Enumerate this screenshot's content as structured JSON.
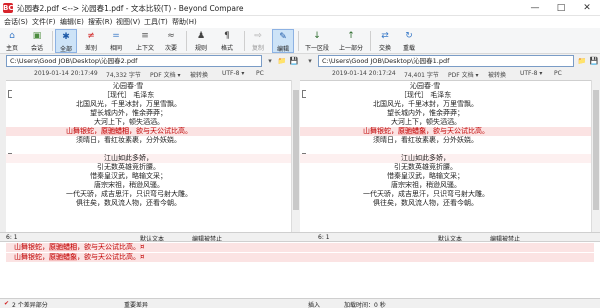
{
  "window": {
    "title": "沁园春2.pdf <--> 沁园春1.pdf - 文本比较(T) - Beyond Compare",
    "app_icon": "BC",
    "controls": [
      "—",
      "□",
      "✕"
    ]
  },
  "menu": [
    "会话(S)",
    "文件(F)",
    "编辑(E)",
    "搜索(R)",
    "视图(V)",
    "工具(T)",
    "帮助(H)"
  ],
  "toolbar": [
    {
      "label": "主页",
      "icon": "home-icon",
      "glyph": "⌂",
      "color": "#3a7ac8"
    },
    {
      "label": "会话",
      "icon": "session-icon",
      "glyph": "▣",
      "color": "#4d8d3f"
    },
    {
      "label": "全部",
      "icon": "all-icon",
      "glyph": "✱",
      "color": "#1e5aa8",
      "active": true
    },
    {
      "label": "差别",
      "icon": "diff-icon",
      "glyph": "≠",
      "color": "#d02020"
    },
    {
      "label": "相同",
      "icon": "same-icon",
      "glyph": "=",
      "color": "#3a7ac8"
    },
    {
      "label": "上下文",
      "icon": "context-icon",
      "glyph": "≡",
      "color": "#555"
    },
    {
      "label": "次要",
      "icon": "minor-icon",
      "glyph": "≈",
      "color": "#555"
    },
    {
      "label": "规则",
      "icon": "rules-icon",
      "glyph": "♟",
      "color": "#444"
    },
    {
      "label": "格式",
      "icon": "format-icon",
      "glyph": "¶",
      "color": "#444"
    },
    {
      "label": "复制",
      "icon": "copy-icon",
      "glyph": "⇨",
      "color": "#aaa",
      "disabled": true
    },
    {
      "label": "编辑",
      "icon": "edit-icon",
      "glyph": "✎",
      "color": "#1e5aa8",
      "active": true
    },
    {
      "label": "下一区段",
      "icon": "next-section-icon",
      "glyph": "↓",
      "color": "#2a6a2a"
    },
    {
      "label": "上一部分",
      "icon": "prev-section-icon",
      "glyph": "↑",
      "color": "#2a6a2a"
    },
    {
      "label": "交换",
      "icon": "swap-icon",
      "glyph": "⇄",
      "color": "#3a7ac8"
    },
    {
      "label": "重载",
      "icon": "reload-icon",
      "glyph": "↻",
      "color": "#3a7ac8"
    }
  ],
  "left": {
    "path": "C:\\Users\\Good JOB\\Desktop\\沁园春2.pdf",
    "info": [
      "2019-01-14 20:17:49",
      "74,332 字节",
      "PDF 文档 ▾",
      "被转换",
      "UTF-8 ▾",
      "PC"
    ],
    "lines": [
      {
        "text": "沁园春·雪",
        "diff": false
      },
      {
        "text": "［现代］ 毛泽东",
        "diff": false
      },
      {
        "text": "北国风光，千里冰封，万里雪飘。",
        "diff": false
      },
      {
        "text": "望长城内外，惟余莽莽；",
        "diff": false
      },
      {
        "text": "大河上下，顿失滔滔。",
        "diff": false
      },
      {
        "pre": "山舞银蛇，",
        "hl": "原驰蜡相",
        "post": "，欲与天公试比高。",
        "diff": true
      },
      {
        "text": "须晴日，看红妆素裹，分外妖娆。",
        "diff": false
      },
      {
        "text": "",
        "diff": false
      },
      {
        "text": "江山如此多娇，",
        "diff": true,
        "soft": true
      },
      {
        "text": "引无数英雄竞折腰。",
        "diff": false
      },
      {
        "text": "惜秦皇汉武，略输文采；",
        "diff": false
      },
      {
        "text": "唐宗宋祖，稍逊风骚。",
        "diff": false
      },
      {
        "text": "一代天骄，成吉思汗，只识弯弓射大雕。",
        "diff": false
      },
      {
        "text": "俱往矣，数风流人物，还看今朝。",
        "diff": false
      }
    ],
    "pos": "6: 1",
    "encoding": "默认文本",
    "edit": "编辑被禁止"
  },
  "right": {
    "path": "C:\\Users\\Good JOB\\Desktop\\沁园春1.pdf",
    "info": [
      "2019-01-14 20:17:24",
      "74,401 字节",
      "PDF 文档 ▾",
      "被转换",
      "UTF-8 ▾",
      "PC"
    ],
    "lines": [
      {
        "text": "沁园春·雪",
        "diff": false
      },
      {
        "text": "［现代］ 毛泽东",
        "diff": false
      },
      {
        "text": "北国风光，千里冰封，万里雪飘。",
        "diff": false
      },
      {
        "text": "望长城内外，惟余莽莽；",
        "diff": false
      },
      {
        "text": "大河上下，顿失滔滔。",
        "diff": false
      },
      {
        "pre": "山舞银蛇，",
        "hl": "原驰蜡象",
        "post": "，欲与天公试比高。",
        "diff": true
      },
      {
        "text": "须晴日，看红妆素裹，分外妖娆。",
        "diff": false
      },
      {
        "text": "",
        "diff": false
      },
      {
        "text": "江山如此多娇，",
        "diff": true,
        "soft": true
      },
      {
        "text": "引无数英雄竞折腰。",
        "diff": false
      },
      {
        "text": "惜秦皇汉武，略输文采；",
        "diff": false
      },
      {
        "text": "唐宗宋祖，稍逊风骚。",
        "diff": false
      },
      {
        "text": "一代天骄，成吉思汗，只识弯弓射大雕。",
        "diff": false
      },
      {
        "text": "俱往矣，数风流人物，还看今朝。",
        "diff": false
      }
    ],
    "pos": "6: 1",
    "encoding": "默认文本",
    "edit": "编辑被禁止"
  },
  "detail": [
    {
      "pre": "山舞银蛇，",
      "hl": "原驰蜡相",
      "post": "，欲与天公试比高。¤"
    },
    {
      "pre": "山舞银蛇，",
      "hl": "原驰蜡象",
      "post": "，欲与天公试比高。¤"
    }
  ],
  "status": {
    "diff_count": "2 个差异部分",
    "importance": "重要差异",
    "mode": "插入",
    "load_time": "加载时间：0 秒"
  },
  "colors": {
    "diff_bg": "#fbe3e3",
    "diff_hl": "#f6c1c1",
    "diff_text": "#c00000",
    "accent": "#3a7ac8"
  }
}
